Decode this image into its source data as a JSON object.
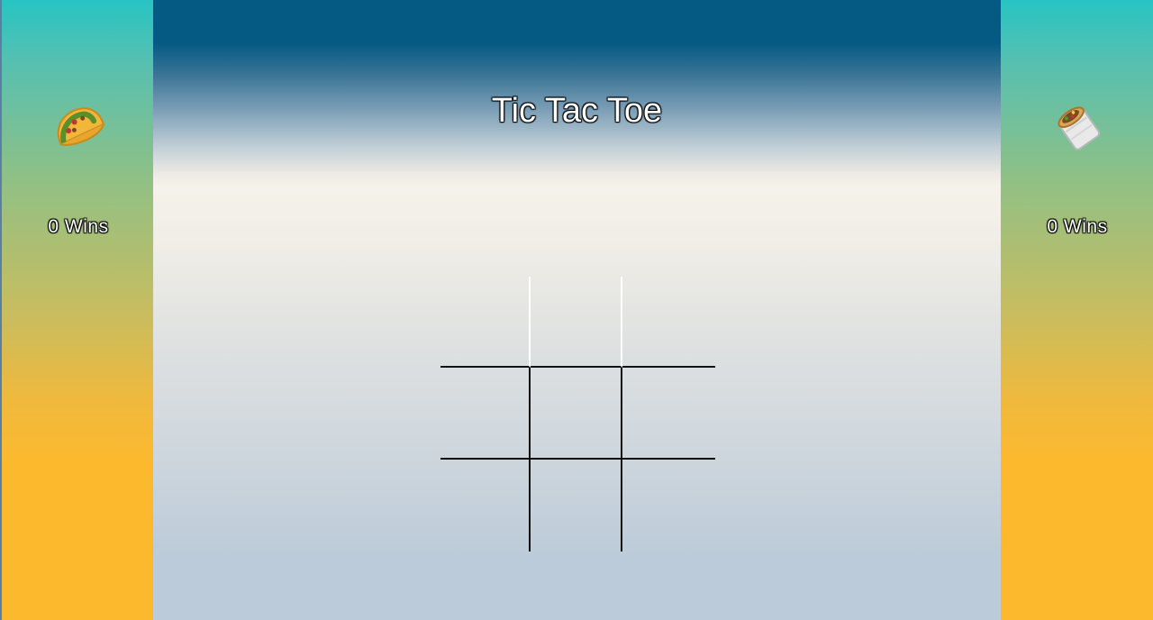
{
  "game": {
    "title": "Tic Tac Toe"
  },
  "players": {
    "left": {
      "icon": "taco-icon",
      "wins_label": "0 Wins"
    },
    "right": {
      "icon": "burrito-icon",
      "wins_label": "0 Wins"
    }
  },
  "board": {
    "cells": [
      "",
      "",
      "",
      "",
      "",
      "",
      "",
      "",
      ""
    ]
  },
  "colors": {
    "side_top": "#27c4c4",
    "side_bottom": "#fdb92e",
    "header_blue": "#055a84",
    "grid_line": "#111111"
  }
}
